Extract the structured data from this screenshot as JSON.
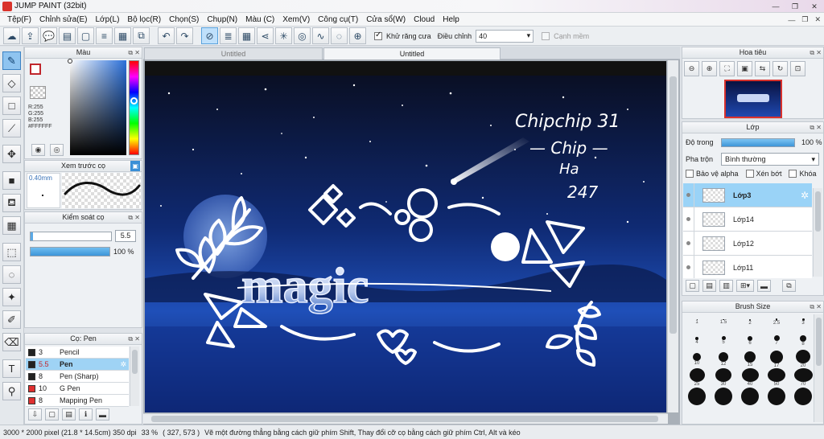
{
  "window": {
    "title": "JUMP PAINT (32bit)",
    "controls": [
      "—",
      "❐",
      "✕"
    ]
  },
  "menu": [
    "Tệp(F)",
    "Chỉnh sửa(E)",
    "Lớp(L)",
    "Bộ lọc(R)",
    "Chọn(S)",
    "Chụp(N)",
    "Màu (C)",
    "Xem(V)",
    "Công cụ(T)",
    "Cửa sổ(W)",
    "Cloud",
    "Help"
  ],
  "menu_controls": [
    "—",
    "❐",
    "✕"
  ],
  "toolbar": {
    "antialias_label": "Khử răng cưa",
    "correction_label": "Điều chỉnh",
    "correction_value": "40",
    "snap_label": "Cạnh mềm"
  },
  "doc_tabs": [
    "Untitled",
    "Untitled"
  ],
  "color_panel": {
    "title": "Màu",
    "r": "R:255",
    "g": "G:255",
    "b": "B:255",
    "hex": "#FFFFFF"
  },
  "preview_panel": {
    "title": "Xem trước cọ",
    "size": "0.40mm"
  },
  "control_panel": {
    "title": "Kiểm soát cọ",
    "size_value": "5.5",
    "opacity_value": "100 %",
    "opacity_fraction": 1.0,
    "size_fraction": 0.03
  },
  "brush_panel": {
    "title": "Cọ: Pen",
    "items": [
      {
        "size": "3",
        "name": "Pencil",
        "color": "#222222"
      },
      {
        "size": "5.5",
        "name": "Pen",
        "color": "#222222",
        "selected": true
      },
      {
        "size": "8",
        "name": "Pen (Sharp)",
        "color": "#222222"
      },
      {
        "size": "10",
        "name": "G Pen",
        "color": "#e03030"
      },
      {
        "size": "8",
        "name": "Mapping Pen",
        "color": "#e03030"
      }
    ]
  },
  "navigator": {
    "title": "Hoa tiêu"
  },
  "layers": {
    "title": "Lớp",
    "opacity_label": "Độ trong",
    "opacity_value": "100 %",
    "blend_label": "Pha trộn",
    "blend_value": "Bình thường",
    "protect_alpha": "Bảo vệ alpha",
    "clip": "Xén bớt",
    "lock": "Khóa",
    "items": [
      {
        "name": "Lớp3",
        "selected": true
      },
      {
        "name": "Lớp14"
      },
      {
        "name": "Lớp12"
      },
      {
        "name": "Lớp11"
      }
    ]
  },
  "brush_size": {
    "title": "Brush Size",
    "labels": [
      "1",
      "1.5",
      "2",
      "2.5",
      "3",
      "4",
      "5",
      "6",
      "7",
      "8",
      "10",
      "12",
      "15",
      "17",
      "20",
      "25",
      "30",
      "40",
      "50",
      "70",
      "",
      "",
      "",
      "",
      ""
    ]
  },
  "status": {
    "dimensions": "3000 * 2000 pixel  (21.8 * 14.5cm)  350 dpi",
    "zoom": "33 %",
    "coords": "( 327, 573 )",
    "hint": "Vẽ một đường thẳng bằng cách giữ phím Shift, Thay đổi cỡ cọ bằng cách giữ phím Ctrl, Alt và kéo"
  },
  "artwork": {
    "handwriting_lines": [
      "Chipchip 31",
      "— Chip —",
      "Ha",
      "247"
    ],
    "logo_text": "magic"
  },
  "colors": {
    "accent": "#3a8fd6",
    "sky": "#0b1c4a",
    "selection": "#9ad3f7"
  }
}
